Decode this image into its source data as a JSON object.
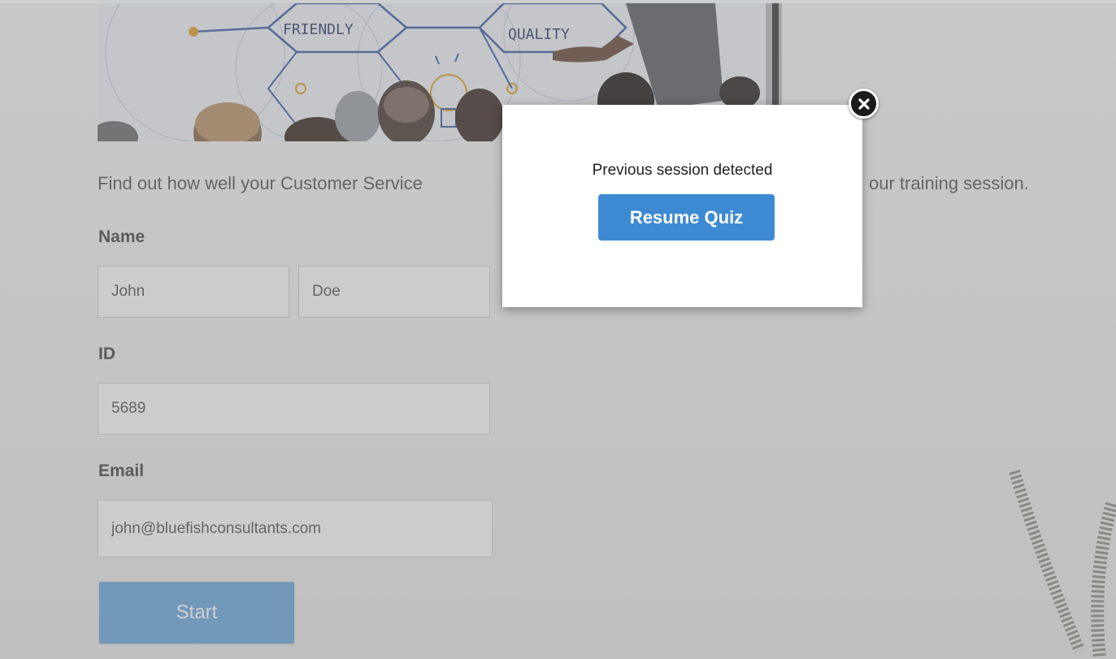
{
  "hero": {
    "words": [
      "FRIENDLY",
      "QUALITY"
    ]
  },
  "intro": {
    "text_left": "Find out how well your Customer Service",
    "text_right": "our training session."
  },
  "form": {
    "name_label": "Name",
    "first_name_value": "John",
    "last_name_value": "Doe",
    "id_label": "ID",
    "id_value": "5689",
    "email_label": "Email",
    "email_value": "john@bluefishconsultants.com",
    "start_label": "Start"
  },
  "modal": {
    "message": "Previous session detected",
    "resume_label": "Resume Quiz",
    "close_icon": "close-icon"
  },
  "colors": {
    "start_button": "#6aa6de",
    "resume_button": "#3d8ad2",
    "overlay": "rgba(128,128,128,0.38)"
  }
}
